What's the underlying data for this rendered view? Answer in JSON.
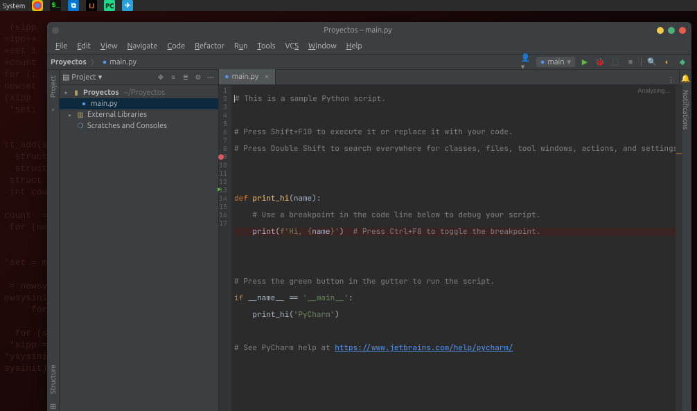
{
  "os_bar": {
    "system_label": "System",
    "term_prompt": "$_"
  },
  "window": {
    "title": "Proyectos – main.py"
  },
  "menu": {
    "file": "File",
    "edit": "Edit",
    "view": "View",
    "navigate": "Navigate",
    "code": "Code",
    "refactor": "Refactor",
    "run": "Run",
    "tools": "Tools",
    "vcs": "VCS",
    "window": "Window",
    "help": "Help"
  },
  "breadcrumb": {
    "project": "Proyectos",
    "file": "main.py"
  },
  "toolbar": {
    "run_config": "main"
  },
  "left_tabs": {
    "project": "Project",
    "structure": "Structure"
  },
  "right_tabs": {
    "notifications": "Notifications"
  },
  "project_panel": {
    "title": "Project",
    "root": "Proyectos",
    "root_path": "~/Proyectos",
    "file": "main.py",
    "external": "External Libraries",
    "scratches": "Scratches and Consoles"
  },
  "editor_tab": {
    "name": "main.py"
  },
  "status": {
    "analyzing": "Analyzing..."
  },
  "code": {
    "l1": "# This is a sample Python script.",
    "l3": "# Press Shift+F10 to execute it or replace it with your code.",
    "l4": "# Press Double Shift to search everywhere for classes, files, tool windows, actions, and settings.",
    "l7_def": "def ",
    "l7_fn": "print_hi",
    "l7_rest": "(name):",
    "l8": "    # Use a breakpoint in the code line below to debug your script.",
    "l9_a": "    print(",
    "l9_b": "f'Hi, {",
    "l9_c": "name",
    "l9_d": "}'",
    "l9_e": ")  ",
    "l9_f": "# Press Ctrl+F8 to toggle the breakpoint.",
    "l12": "# Press the green button in the gutter to run the script.",
    "l13_if": "if ",
    "l13_name": "__name__",
    "l13_eq": " == ",
    "l13_main": "'__main__'",
    "l13_colon": ":",
    "l14_a": "    print_hi(",
    "l14_b": "'PyCharm'",
    "l14_c": ")",
    "l16_a": "# See PyCharm help at ",
    "l16_b": "https://www.jetbrains.com/help/pycharm/"
  },
  "line_numbers": [
    "1",
    "2",
    "3",
    "4",
    "5",
    "6",
    "7",
    "8",
    "9",
    "10",
    "11",
    "12",
    "13",
    "14",
    "15",
    "16",
    "17"
  ]
}
